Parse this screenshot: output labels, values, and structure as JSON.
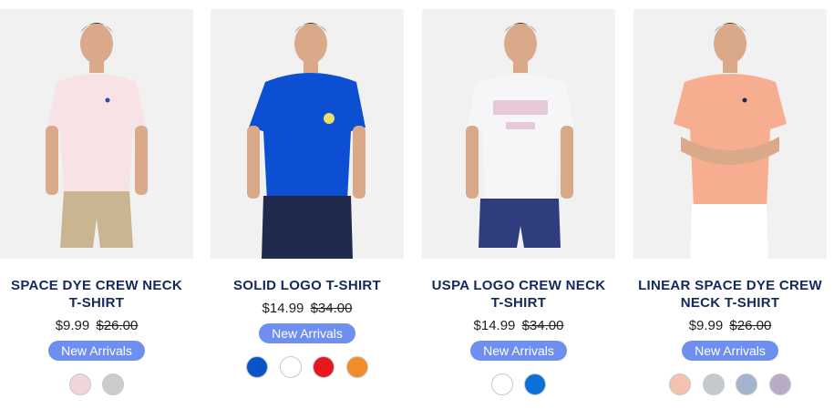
{
  "products": [
    {
      "name": "SPACE DYE CREW NECK T-SHIRT",
      "name_lines": [
        "SPACE DYE CREW NECK",
        "T-SHIRT"
      ],
      "price": "$9.99",
      "old_price": "$26.00",
      "badge": "New Arrivals",
      "shirt_color": "#f7e3e6",
      "shorts_color": "#c9b592",
      "swatches": [
        "#f0d6da",
        "#c9cbcd"
      ]
    },
    {
      "name": "SOLID LOGO T-SHIRT",
      "name_lines": [
        "SOLID LOGO T-SHIRT"
      ],
      "price": "$14.99",
      "old_price": "$34.00",
      "badge": "New Arrivals",
      "shirt_color": "#0d4fd3",
      "shorts_color": "#1f2a4d",
      "swatches": [
        "#0a54c9",
        "#ffffff",
        "#e8171c",
        "#f28c28"
      ]
    },
    {
      "name": "USPA LOGO CREW NECK T-SHIRT",
      "name_lines": [
        "USPA LOGO CREW NECK",
        "T-SHIRT"
      ],
      "price": "$14.99",
      "old_price": "$34.00",
      "badge": "New Arrivals",
      "shirt_color": "#f6f6f8",
      "shorts_color": "#2f3d7e",
      "swatches": [
        "#ffffff",
        "#0d6fd8"
      ]
    },
    {
      "name": "LINEAR SPACE DYE CREW NECK T-SHIRT",
      "name_lines": [
        "LINEAR SPACE DYE CREW",
        "NECK T-SHIRT"
      ],
      "price": "$9.99",
      "old_price": "$26.00",
      "badge": "New Arrivals",
      "shirt_color": "#f7ae90",
      "shorts_color": "#ffffff",
      "swatches": [
        "#f4c3b0",
        "#c6c9cc",
        "#a4b3d0",
        "#b9abc4"
      ]
    }
  ]
}
